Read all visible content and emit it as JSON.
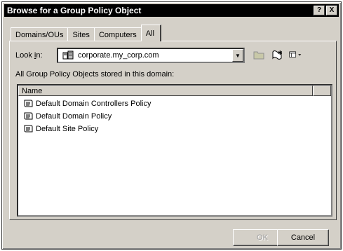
{
  "dialog": {
    "title": "Browse for a Group Policy Object",
    "help_button": "?",
    "close_button": "X"
  },
  "tabs": [
    {
      "label": "Domains/OUs"
    },
    {
      "label": "Sites"
    },
    {
      "label": "Computers"
    },
    {
      "label": "All",
      "active": true
    }
  ],
  "look_in": {
    "label_pre": "Look ",
    "label_accel": "i",
    "label_post": "n:",
    "value": "corporate.my_corp.com"
  },
  "stored_label": "All Group Policy Objects stored in this domain:",
  "list": {
    "column_header": "Name",
    "items": [
      "Default Domain Controllers Policy",
      "Default Domain Policy",
      "Default Site Policy"
    ]
  },
  "buttons": {
    "ok": "OK",
    "cancel": "Cancel"
  },
  "icons": {
    "gpo": "gpo-scroll-icon",
    "domain": "domain-icon",
    "up_folder": "up-one-level-icon",
    "new_gpo": "create-gpo-icon",
    "view": "view-menu-icon"
  }
}
